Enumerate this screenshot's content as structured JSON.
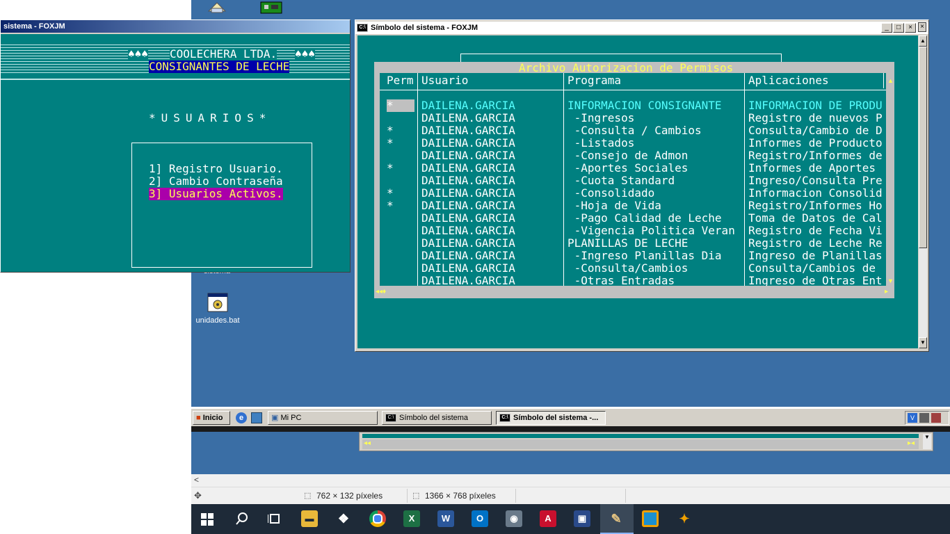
{
  "left_window": {
    "title": "sistema - FOXJM",
    "company": "COOLECHERA LTDA.",
    "company_trees_left": "♠♠♠",
    "company_trees_right": "♠♠♠",
    "subtitle": "CONSIGNANTES DE LECHE",
    "section": "*USUARIOS*",
    "menu": [
      "1] Registro Usuario.",
      "2] Cambio Contraseña",
      "3] Usuarios Activos."
    ]
  },
  "desktop": {
    "icon_partial_label": "sistema",
    "icon_bat_label": "unidades.bat"
  },
  "right_window": {
    "title": "Símbolo del sistema - FOXJM",
    "controls": {
      "minimize": "_",
      "maximize": "□",
      "close": "×"
    },
    "box_title": "Archivo Autorizacion de Permisos",
    "headers": [
      "Perm",
      "Usuario",
      "Programa",
      "Aplicaciones"
    ],
    "rows": [
      {
        "perm": "*",
        "usuario": "DAILENA.GARCIA",
        "programa": "INFORMACION CONSIGNANTE",
        "aplicacion": "INFORMACION DE PRODU"
      },
      {
        "perm": "",
        "usuario": "DAILENA.GARCIA",
        "programa": " -Ingresos",
        "aplicacion": "Registro de nuevos P"
      },
      {
        "perm": "*",
        "usuario": "DAILENA.GARCIA",
        "programa": " -Consulta / Cambios",
        "aplicacion": "Consulta/Cambio de D"
      },
      {
        "perm": "*",
        "usuario": "DAILENA.GARCIA",
        "programa": " -Listados",
        "aplicacion": "Informes de Producto"
      },
      {
        "perm": "",
        "usuario": "DAILENA.GARCIA",
        "programa": " -Consejo de Admon",
        "aplicacion": "Registro/Informes de"
      },
      {
        "perm": "*",
        "usuario": "DAILENA.GARCIA",
        "programa": " -Aportes Sociales",
        "aplicacion": "Informes de Aportes"
      },
      {
        "perm": "",
        "usuario": "DAILENA.GARCIA",
        "programa": " -Cuota Standard",
        "aplicacion": "Ingreso/Consulta Pre"
      },
      {
        "perm": "*",
        "usuario": "DAILENA.GARCIA",
        "programa": " -Consolidado",
        "aplicacion": "Informacion Consolid"
      },
      {
        "perm": "*",
        "usuario": "DAILENA.GARCIA",
        "programa": " -Hoja de Vida",
        "aplicacion": "Registro/Informes Ho"
      },
      {
        "perm": "",
        "usuario": "DAILENA.GARCIA",
        "programa": " -Pago Calidad de Leche",
        "aplicacion": "Toma de Datos de Cal"
      },
      {
        "perm": "",
        "usuario": "DAILENA.GARCIA",
        "programa": " -Vigencia Politica Veran",
        "aplicacion": "Registro de Fecha Vi"
      },
      {
        "perm": "",
        "usuario": "DAILENA.GARCIA",
        "programa": "PLANILLAS DE LECHE",
        "aplicacion": "Registro de Leche Re"
      },
      {
        "perm": "",
        "usuario": "DAILENA.GARCIA",
        "programa": " -Ingreso Planillas Dia",
        "aplicacion": "Ingreso de Planillas"
      },
      {
        "perm": "",
        "usuario": "DAILENA.GARCIA",
        "programa": " -Consulta/Cambios",
        "aplicacion": "Consulta/Cambios de"
      },
      {
        "perm": "",
        "usuario": "DAILENA.GARCIA",
        "programa": " -Otras Entradas",
        "aplicacion": "Ingreso de Otras Ent"
      }
    ]
  },
  "old_taskbar": {
    "start": "Inicio",
    "buttons": [
      "Mi PC",
      "Símbolo del sistema",
      "Símbolo del sistema -..."
    ]
  },
  "viewer_status": {
    "selection": "762 × 132 píxeles",
    "image_size": "1366 × 768 píxeles"
  },
  "win10_taskbar": {
    "icons": [
      "windows-start",
      "search",
      "task-view",
      "file-explorer",
      "dropbox",
      "chrome",
      "excel",
      "word",
      "outlook",
      "camera",
      "acrobat",
      "remote-desktop",
      "paint",
      "vmware",
      "foxpro"
    ]
  },
  "colors": {
    "teal": "#008080",
    "desktop_blue": "#3a6ea5",
    "highlight_magenta": "#aa00aa",
    "highlight_blue": "#0000aa"
  }
}
